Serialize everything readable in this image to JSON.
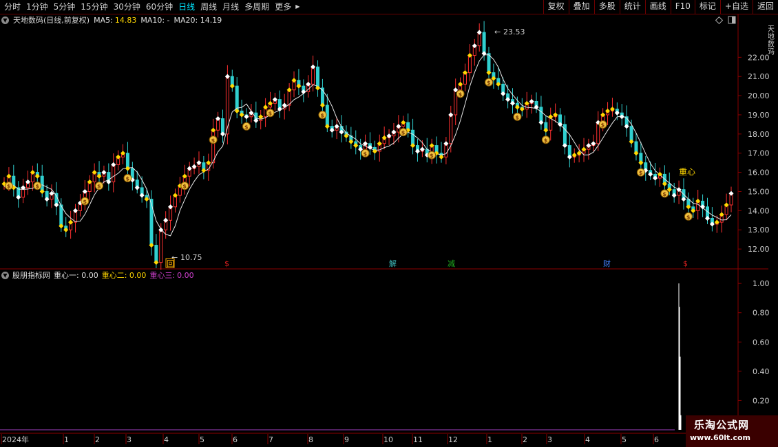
{
  "toolbar": {
    "periods": [
      "分时",
      "1分钟",
      "5分钟",
      "15分钟",
      "30分钟",
      "60分钟",
      "日线",
      "周线",
      "月线",
      "多周期",
      "更多"
    ],
    "active_period": "日线",
    "more_arrow": "▶",
    "tools": [
      "复权",
      "叠加",
      "多股",
      "统计",
      "画线",
      "F10",
      "标记",
      "+自选",
      "返回"
    ]
  },
  "main_info": {
    "title": "天地数码(日线,前复权)",
    "ma5_label": "MA5:",
    "ma5_value": "14.83",
    "ma10_label": "MA10: -",
    "ma20_label": "MA20: 14.19"
  },
  "indicator_info": {
    "title": "股朋指标网",
    "l1": "重心一: 0.00",
    "l2": "重心二: 0.00",
    "l3_label": "重心三:",
    "l3_value": "0.00"
  },
  "chart_data": [
    {
      "type": "candlestick",
      "title": "天地数码(日线,前复权)",
      "y_ticks": [
        "22.00",
        "21.00",
        "20.00",
        "19.00",
        "18.00",
        "17.00",
        "16.00",
        "15.00",
        "14.00",
        "13.00",
        "12.00"
      ],
      "ylim": [
        11.0,
        24.2
      ],
      "high_label": "23.53",
      "low_label": "10.75",
      "close_path": [
        15.4,
        15.8,
        15.2,
        14.7,
        15.2,
        15.5,
        16.0,
        15.8,
        15.0,
        14.6,
        14.9,
        14.3,
        13.2,
        13.0,
        13.4,
        14.0,
        14.4,
        15.0,
        15.5,
        16.0,
        15.8,
        16.0,
        15.5,
        16.4,
        16.8,
        17.0,
        16.2,
        15.6,
        15.2,
        14.8,
        14.6,
        12.2,
        11.3,
        13.0,
        13.5,
        14.2,
        14.8,
        15.3,
        15.8,
        16.2,
        16.3,
        16.5,
        16.1,
        16.5,
        18.2,
        18.8,
        18.0,
        21.0,
        20.5,
        19.2,
        19.0,
        18.9,
        19.1,
        18.7,
        18.9,
        19.4,
        19.6,
        19.8,
        19.3,
        19.5,
        20.3,
        20.8,
        20.5,
        20.2,
        20.6,
        21.5,
        20.4,
        19.5,
        18.4,
        18.2,
        18.4,
        18.1,
        17.9,
        17.6,
        17.4,
        17.2,
        17.5,
        17.3,
        17.1,
        17.5,
        17.8,
        17.9,
        18.1,
        18.4,
        18.6,
        18.2,
        17.4,
        17.1,
        17.2,
        16.9,
        17.4,
        17.0,
        16.8,
        17.5,
        19.0,
        20.3,
        20.6,
        21.2,
        22.1,
        22.6,
        23.3,
        22.2,
        21.2,
        20.9,
        20.6,
        20.1,
        19.8,
        19.6,
        19.4,
        19.3,
        19.6,
        19.7,
        19.4,
        18.6,
        18.2,
        18.9,
        19.0,
        18.5,
        17.4,
        16.8,
        16.9,
        17.0,
        17.2,
        17.4,
        17.5,
        18.6,
        19.0,
        19.2,
        19.3,
        19.1,
        18.9,
        18.4,
        17.6,
        17.0,
        16.5,
        16.1,
        15.9,
        15.7,
        15.9,
        15.4,
        15.1,
        14.8,
        15.1,
        14.6,
        14.2,
        14.0,
        14.5,
        14.2,
        13.6,
        13.3,
        13.4,
        13.8,
        14.3,
        14.9
      ],
      "markers": [
        {
          "label": "回",
          "color": "#ffb000"
        },
        {
          "label": "$",
          "color": "#e02020"
        },
        {
          "label": "解",
          "color": "#40c0c0"
        },
        {
          "label": "减",
          "color": "#20b020"
        },
        {
          "label": "财",
          "color": "#4080ff"
        },
        {
          "label": "$",
          "color": "#e02020"
        }
      ],
      "annotation": "重心"
    },
    {
      "type": "line",
      "title": "股朋指标网",
      "y_ticks": [
        "1.00",
        "0.80",
        "0.60",
        "0.40",
        "0.20"
      ],
      "ylim": [
        0,
        1.09
      ],
      "spike_values": [
        1.0,
        0.84,
        0.5,
        0.1
      ]
    }
  ],
  "time_axis": {
    "labels": [
      "2024年",
      "1",
      "2",
      "3",
      "4",
      "5",
      "6",
      "7",
      "8",
      "9",
      "10",
      "11",
      "12",
      "1",
      "2",
      "3",
      "4",
      "5",
      "6"
    ]
  },
  "watermark": {
    "line1": "乐淘公式网",
    "line2": "www.60lt.com"
  },
  "side_text": "天地数码"
}
